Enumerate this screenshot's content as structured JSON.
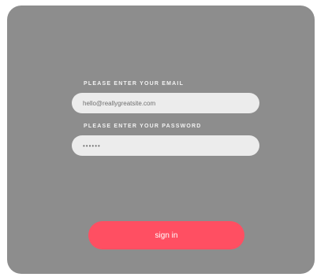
{
  "login": {
    "email_label": "PLEASE ENTER YOUR EMAIL",
    "email_value": "hello@reallygreatsite.com",
    "password_label": "PLEASE ENTER YOUR PASSWORD",
    "password_value": "••••••",
    "submit_label": "sign in"
  },
  "colors": {
    "card_background": "#8d8d8d",
    "field_background": "#ececec",
    "button_background": "#ff4f62",
    "label_text": "#f2f2f2"
  }
}
